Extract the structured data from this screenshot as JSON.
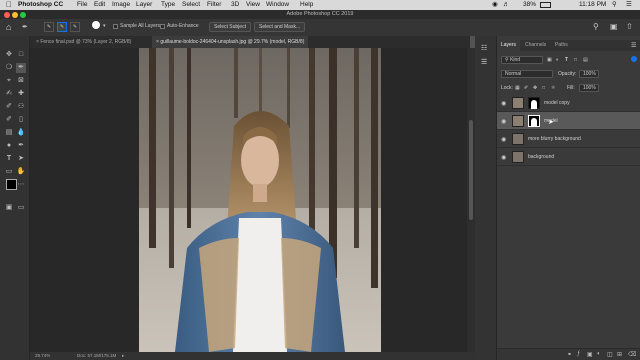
{
  "menubar": {
    "app_name": "Photoshop CC",
    "menus": [
      "File",
      "Edit",
      "Image",
      "Layer",
      "Type",
      "Select",
      "Filter",
      "3D",
      "View",
      "Window",
      "Help"
    ],
    "battery": "38%",
    "clock": "11:18 PM"
  },
  "window": {
    "title": "Adobe Photoshop CC 2019"
  },
  "options": {
    "sample_all_layers": "Sample All Layers",
    "auto_enhance": "Auto-Enhance",
    "select_subject": "Select Subject",
    "select_mask": "Select and Mask..."
  },
  "doc_tabs": [
    "Fence final.psd @ 73% (Layer 2, RGB/8)",
    "guillaume-boldoc-246404-unsplash.jpg @ 29.7% (model, RGB/8)"
  ],
  "status": {
    "zoom": "29.74%",
    "doc": "Doc: 57.1M/175.1M"
  },
  "layers_panel": {
    "tabs": [
      "Layers",
      "Channels",
      "Paths"
    ],
    "kind_filter": "Kind",
    "blend_mode": "Normal",
    "opacity_label": "Opacity:",
    "opacity_value": "100%",
    "lock_label": "Lock:",
    "fill_label": "Fill:",
    "fill_value": "100%",
    "layers": [
      {
        "name": "model copy",
        "selected": false
      },
      {
        "name": "model",
        "selected": true
      },
      {
        "name": "more blurry background",
        "selected": false
      },
      {
        "name": "background",
        "selected": false
      }
    ]
  },
  "colors": {
    "accent": "#1473e6",
    "menubar": "#d9d9d9",
    "panel": "#3a3a3a",
    "canvas": "#282828"
  }
}
